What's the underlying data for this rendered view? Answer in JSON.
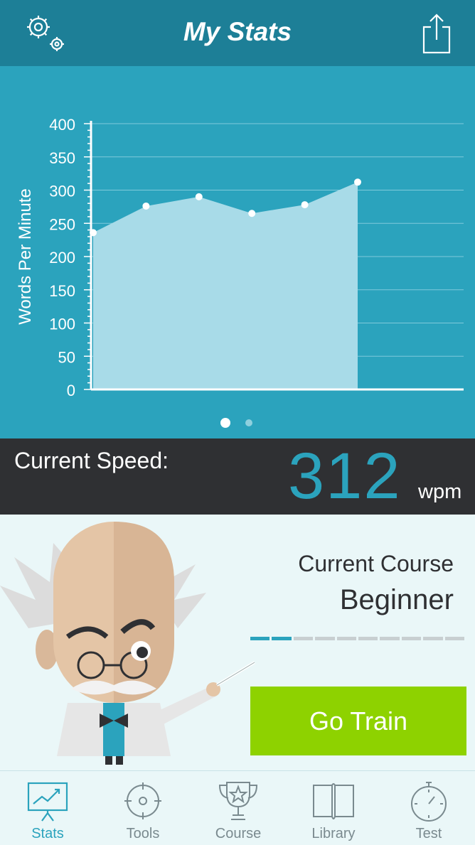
{
  "header": {
    "title": "My Stats",
    "settings_icon": "gear-icon",
    "share_icon": "share-icon"
  },
  "chart_data": {
    "type": "area",
    "ylabel": "Words Per Minute",
    "xlabel": "",
    "ylim": [
      0,
      400
    ],
    "yticks": [
      0,
      50,
      100,
      150,
      200,
      250,
      300,
      350,
      400
    ],
    "x": [
      1,
      2,
      3,
      4,
      5,
      6
    ],
    "values": [
      236,
      276,
      290,
      265,
      278,
      312
    ],
    "grid": true
  },
  "pager": {
    "pages": 2,
    "active": 0
  },
  "speed": {
    "label": "Current Speed:",
    "value": "312",
    "unit": "wpm"
  },
  "course": {
    "label": "Current Course",
    "name": "Beginner",
    "progress_segments": 10,
    "completed_segments": 2
  },
  "go_button": {
    "label": "Go Train"
  },
  "tabs": [
    {
      "label": "Stats",
      "icon": "chart-board-icon",
      "active": true
    },
    {
      "label": "Tools",
      "icon": "crosshair-icon",
      "active": false
    },
    {
      "label": "Course",
      "icon": "trophy-icon",
      "active": false
    },
    {
      "label": "Library",
      "icon": "book-icon",
      "active": false
    },
    {
      "label": "Test",
      "icon": "stopwatch-icon",
      "active": false
    }
  ],
  "colors": {
    "header": "#1d7f97",
    "chart_bg": "#2ba3bd",
    "accent": "#2ba3bd",
    "button": "#8ed200",
    "dark": "#2f3033"
  }
}
